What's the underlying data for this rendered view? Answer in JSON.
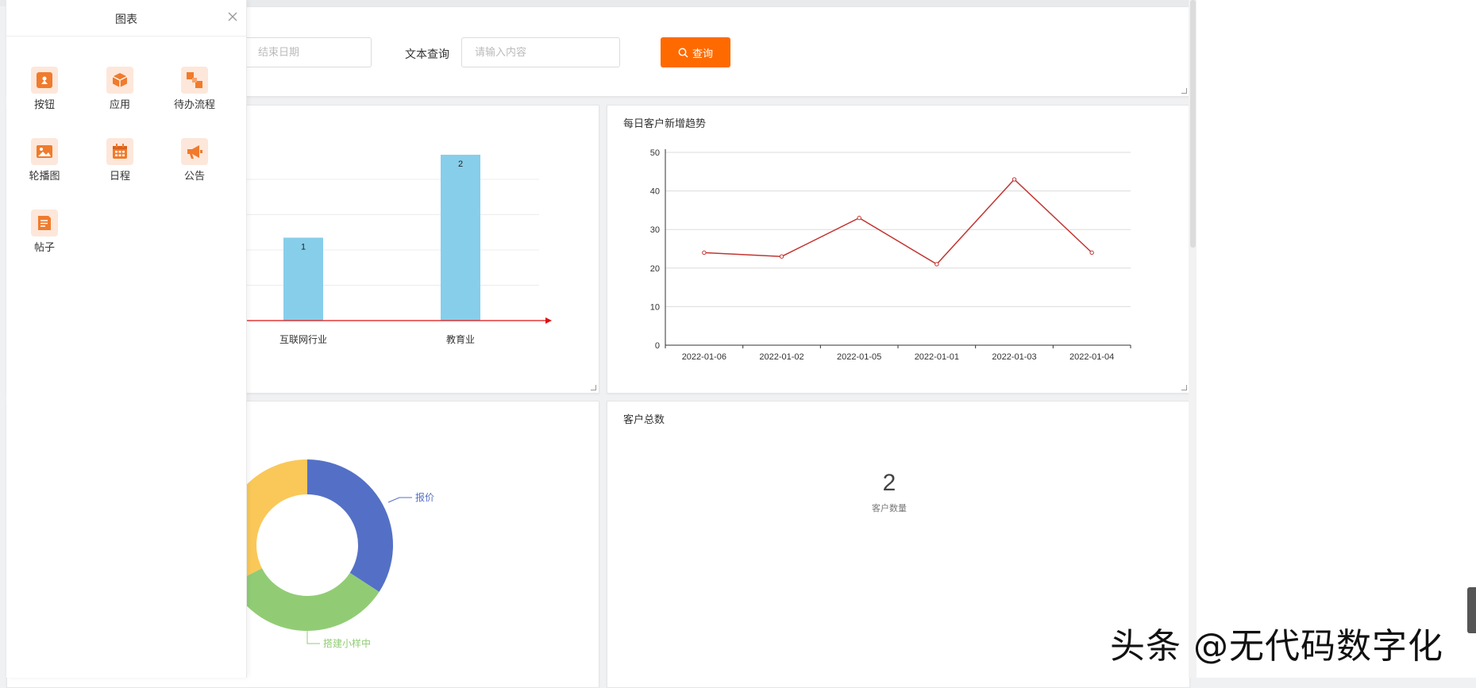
{
  "search": {
    "end_date_placeholder": "结束日期",
    "text_query_label": "文本查询",
    "text_query_placeholder": "请输入内容",
    "query_button": "查询"
  },
  "drawer": {
    "title": "图表",
    "items": [
      {
        "label": "按钮",
        "icon": "button-icon"
      },
      {
        "label": "应用",
        "icon": "cube-icon"
      },
      {
        "label": "待办流程",
        "icon": "flow-icon"
      },
      {
        "label": "轮播图",
        "icon": "image-icon"
      },
      {
        "label": "日程",
        "icon": "calendar-icon"
      },
      {
        "label": "公告",
        "icon": "megaphone-icon"
      },
      {
        "label": "帖子",
        "icon": "post-icon"
      }
    ]
  },
  "bar_card": {
    "chart_data": {
      "type": "bar",
      "categories": [
        "互联网行业",
        "教育业"
      ],
      "values": [
        1,
        2
      ],
      "ylim": [
        0,
        2
      ],
      "color": "#87ceeb",
      "axis_color": "#e01010"
    }
  },
  "line_card": {
    "title": "每日客户新增趋势",
    "chart_data": {
      "type": "line",
      "x": [
        "2022-01-06",
        "2022-01-02",
        "2022-01-05",
        "2022-01-01",
        "2022-01-03",
        "2022-01-04"
      ],
      "values": [
        24,
        23,
        33,
        21,
        43,
        24
      ],
      "ylim": [
        0,
        50
      ],
      "yticks": [
        "0",
        "10",
        "20",
        "30",
        "40",
        "50"
      ],
      "color": "#c23531"
    }
  },
  "donut_card": {
    "chart_data": {
      "type": "pie",
      "labels": [
        "报价",
        "搭建小样中"
      ],
      "colors": [
        "#5470c6",
        "#91cc75",
        "#fac858"
      ],
      "label_colors": [
        "#5470c6",
        "#91cc75"
      ]
    }
  },
  "total_card": {
    "title": "客户总数",
    "value": "2",
    "caption": "客户数量"
  },
  "watermark": "头条 @无代码数字化"
}
